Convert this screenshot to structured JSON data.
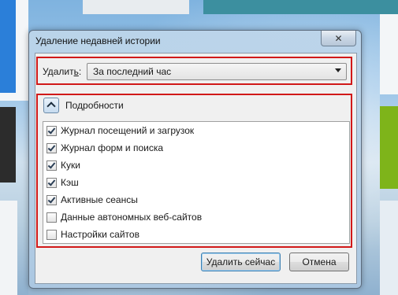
{
  "window": {
    "title": "Удаление недавней истории",
    "close_glyph": "✕"
  },
  "time_range": {
    "label_before": "Удалит",
    "label_underlined": "ь",
    "label_after": ":",
    "selected": "За последний час"
  },
  "details": {
    "label": "Подробности",
    "expanded": true
  },
  "items": [
    {
      "label": "Журнал посещений и загрузок",
      "checked": true
    },
    {
      "label": "Журнал форм и поиска",
      "checked": true
    },
    {
      "label": "Куки",
      "checked": true
    },
    {
      "label": "Кэш",
      "checked": true
    },
    {
      "label": "Активные сеансы",
      "checked": true
    },
    {
      "label": "Данные автономных веб-сайтов",
      "checked": false
    },
    {
      "label": "Настройки сайтов",
      "checked": false
    }
  ],
  "buttons": {
    "delete_now": "Удалить сейчас",
    "cancel": "Отмена"
  },
  "colors": {
    "highlight_border": "#d11919"
  }
}
